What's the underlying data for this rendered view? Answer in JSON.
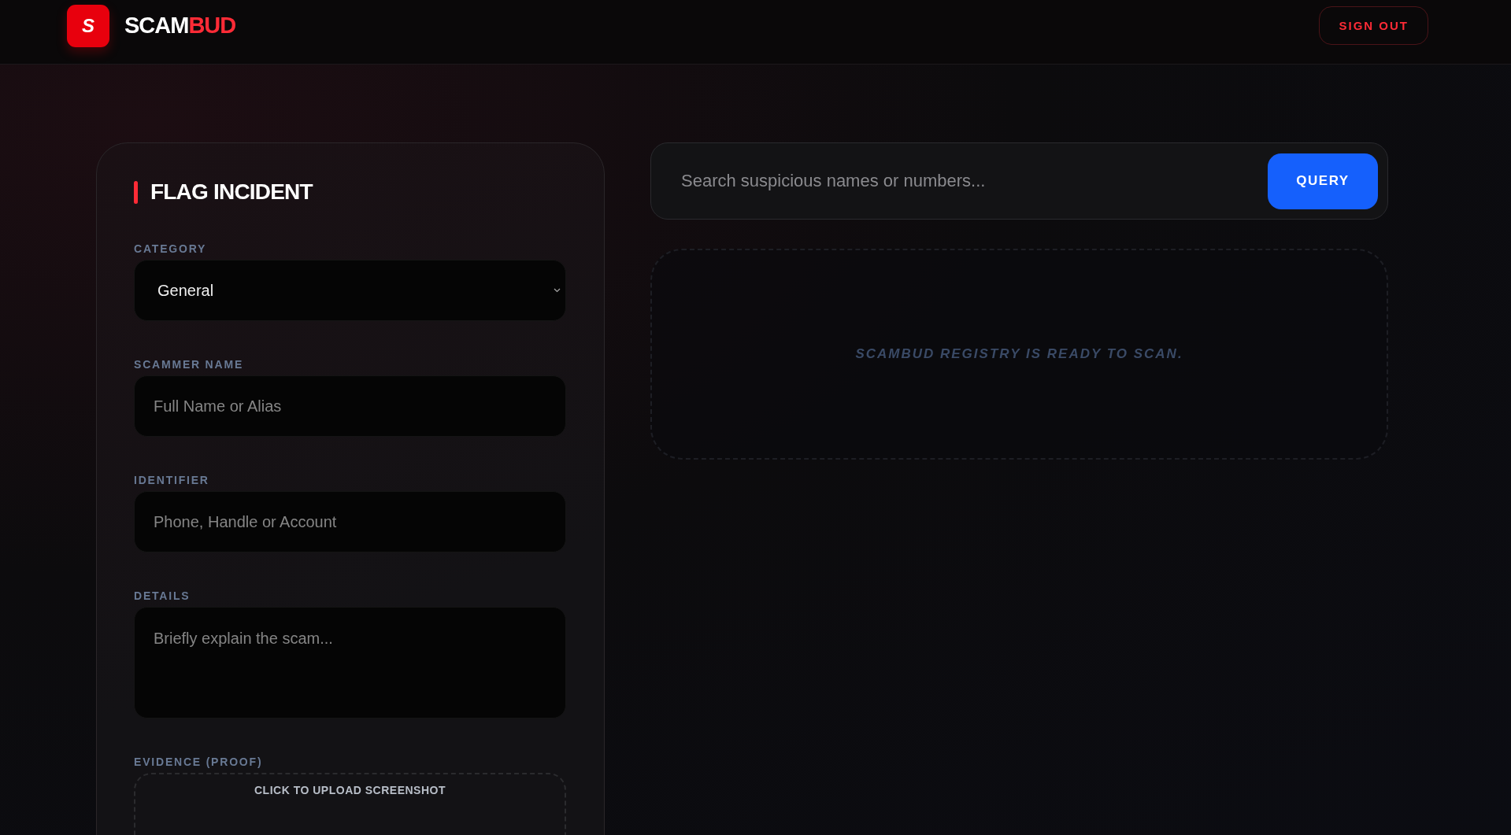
{
  "header": {
    "logo_letter": "S",
    "brand": {
      "main": "SCAM",
      "accent": "BUD"
    },
    "sign_out": "SIGN OUT"
  },
  "report_form": {
    "title": "FLAG INCIDENT",
    "fields": [
      {
        "kind": "select",
        "label": "CATEGORY",
        "value": "General"
      },
      {
        "kind": "input",
        "label": "SCAMMER NAME",
        "placeholder": "Full Name or Alias"
      },
      {
        "kind": "input",
        "label": "IDENTIFIER",
        "placeholder": "Phone, Handle or Account"
      },
      {
        "kind": "textarea",
        "label": "DETAILS",
        "placeholder": "Briefly explain the scam..."
      },
      {
        "kind": "upload",
        "label": "EVIDENCE (PROOF)",
        "prompt": "CLICK TO UPLOAD SCREENSHOT"
      }
    ]
  },
  "search": {
    "placeholder": "Search suspicious names or numbers...",
    "button": "QUERY"
  },
  "results": {
    "message": "SCAMBUD REGISTRY IS READY TO SCAN."
  }
}
